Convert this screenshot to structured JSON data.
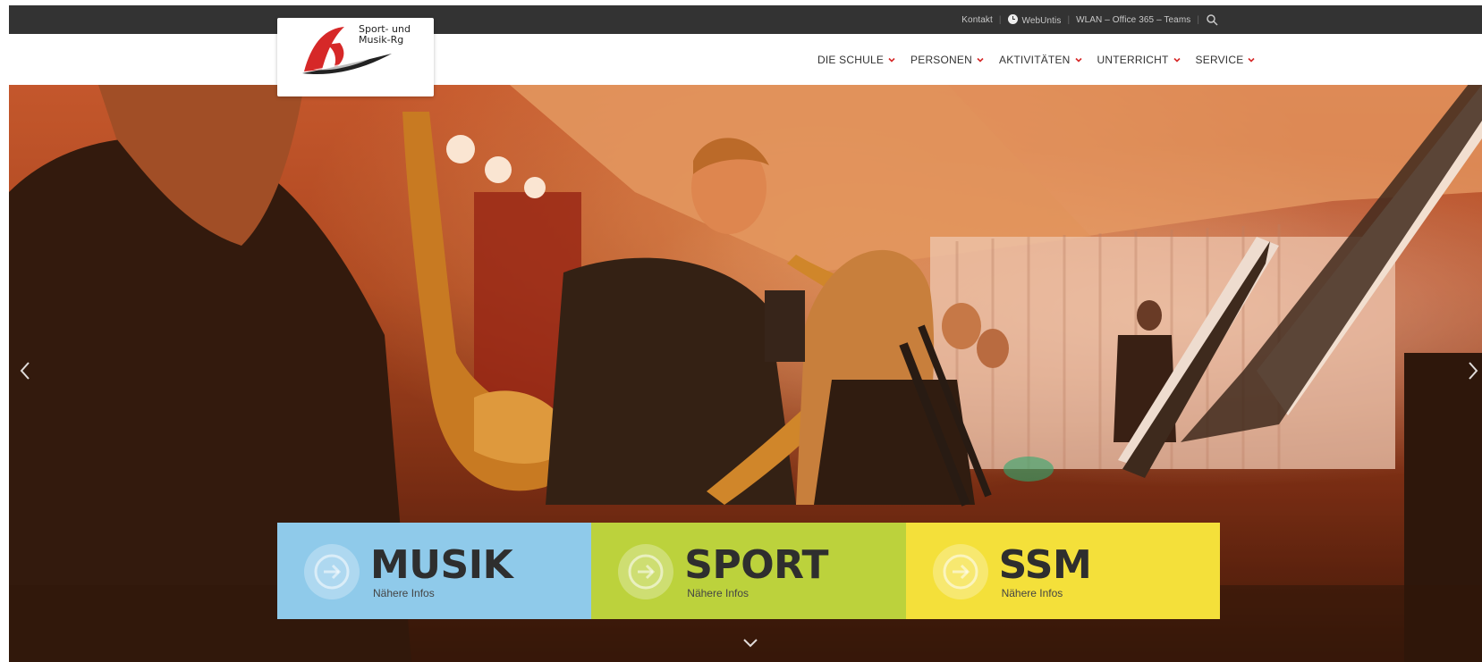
{
  "topbar": {
    "links": [
      "Kontakt",
      "WebUntis",
      "WLAN – Office 365 – Teams"
    ]
  },
  "logo": {
    "line1": "Sport- und",
    "line2": "Musik-Rg"
  },
  "nav": {
    "items": [
      "DIE SCHULE",
      "PERSONEN",
      "AKTIVITÄTEN",
      "UNTERRICHT",
      "SERVICE"
    ]
  },
  "tiles": [
    {
      "title": "MUSIK",
      "subtitle": "Nähere Infos",
      "color": "#8fcaea"
    },
    {
      "title": "SPORT",
      "subtitle": "Nähere Infos",
      "color": "#bcd23c"
    },
    {
      "title": "SSM",
      "subtitle": "Nähere Infos",
      "color": "#f4e03a"
    }
  ],
  "colors": {
    "topbar": "#333333",
    "accent": "#d62828"
  },
  "icons": {
    "clock": "clock-icon",
    "search": "search-icon",
    "chevron": "chevron-down-icon",
    "tile_arrow": "circle-arrow-icon",
    "slider_prev": "chevron-left-icon",
    "slider_next": "chevron-right-icon",
    "scroll": "chevron-down-icon"
  }
}
